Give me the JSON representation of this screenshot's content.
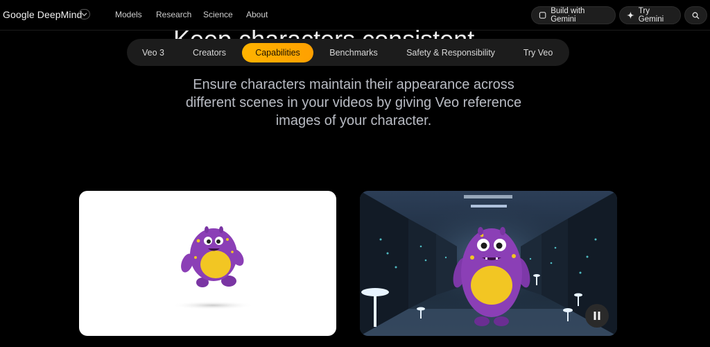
{
  "header": {
    "logo": "Google DeepMind",
    "nav": [
      "Models",
      "Research",
      "Science",
      "About"
    ],
    "build_label": "Build with Gemini",
    "try_label": "Try Gemini"
  },
  "hero": {
    "heading_cut": "Keep characters consistent"
  },
  "tabs": [
    "Veo 3",
    "Creators",
    "Capabilities",
    "Benchmarks",
    "Safety & Responsibility",
    "Try Veo"
  ],
  "active_tab": "Capabilities",
  "lead": "Ensure characters maintain their appearance across different scenes in your videos by giving Veo reference images of your character.",
  "icons": {
    "chevron": "chevron-down-icon",
    "sparkle": "sparkle-icon",
    "search": "search-icon",
    "pause": "pause-icon"
  },
  "colors": {
    "accent": "#ffb300",
    "monster_body": "#8b3fb6",
    "monster_belly": "#f2c623"
  }
}
